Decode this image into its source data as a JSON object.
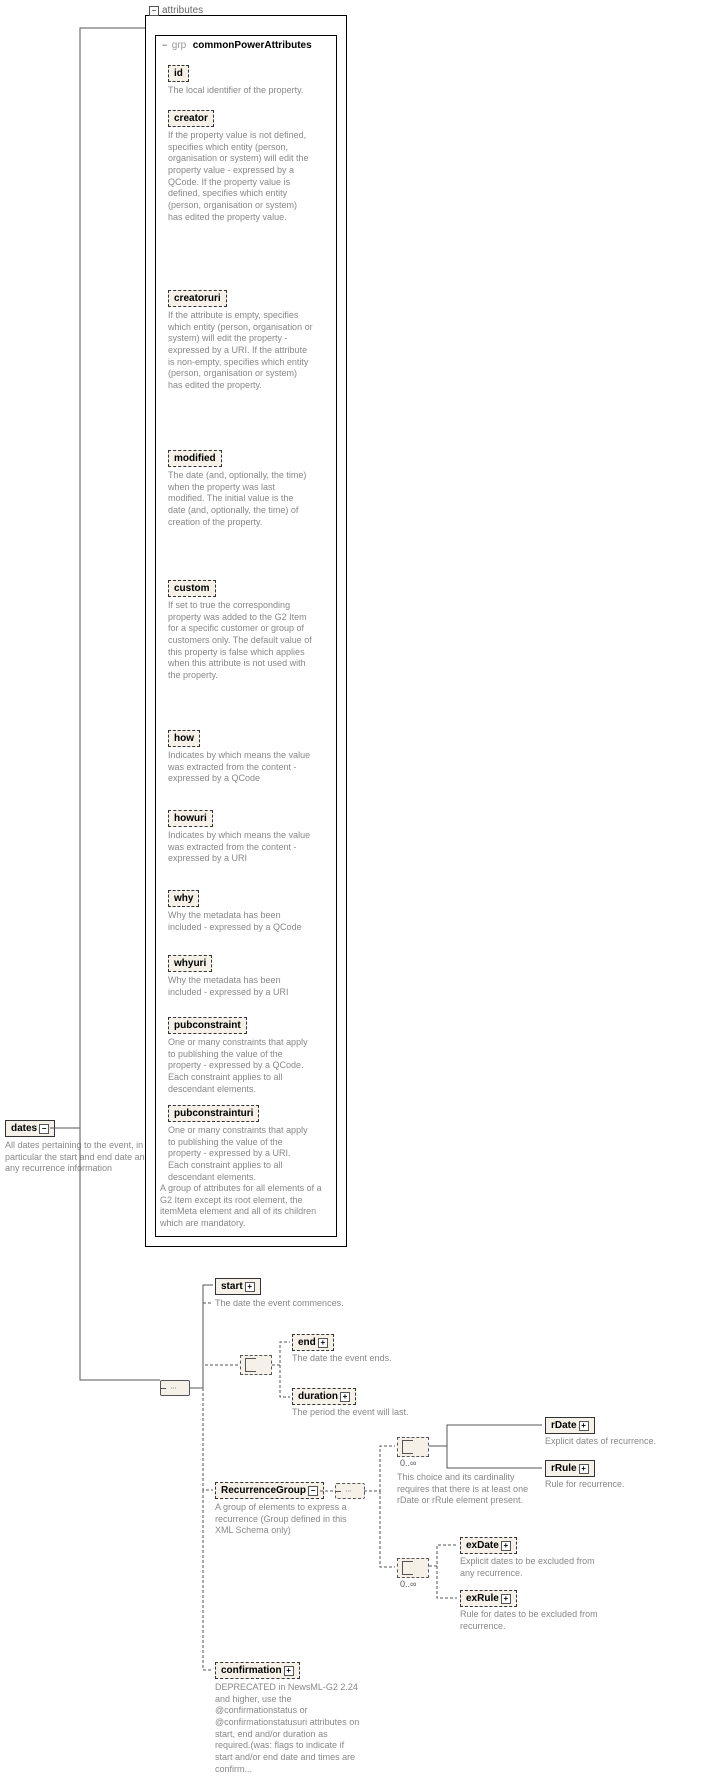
{
  "root": {
    "dates": {
      "label": "dates",
      "desc": "All dates pertaining to the event, in particular the start and end date and any recurrence information"
    }
  },
  "attributes": {
    "label": "attributes",
    "group": {
      "prefix": "grp",
      "name": "commonPowerAttributes",
      "footer_desc": "A group of attributes for all elements of a G2 Item except its root element, the itemMeta element and all of its children which are mandatory.",
      "items": [
        {
          "name": "id",
          "desc": "The local identifier of the property."
        },
        {
          "name": "creator",
          "desc": "If the property value is not defined, specifies which entity (person, organisation or system) will edit the property value - expressed by a QCode. If the property value is defined, specifies which entity (person, organisation or system) has edited the property value."
        },
        {
          "name": "creatoruri",
          "desc": "If the attribute is empty, specifies which entity (person, organisation or system) will edit the property - expressed by a URI. If the attribute is non-empty, specifies which entity (person, organisation or system) has edited the property."
        },
        {
          "name": "modified",
          "desc": "The date (and, optionally, the time) when the property was last modified. The initial value is the date (and, optionally, the time) of creation of the property."
        },
        {
          "name": "custom",
          "desc": "If set to true the corresponding property was added to the G2 Item for a specific customer or group of customers only. The default value of this property is false which applies when this attribute is not used with the property."
        },
        {
          "name": "how",
          "desc": "Indicates by which means the value was extracted from the content - expressed by a QCode"
        },
        {
          "name": "howuri",
          "desc": "Indicates by which means the value was extracted from the content - expressed by a URI"
        },
        {
          "name": "why",
          "desc": "Why the metadata has been included - expressed by a QCode"
        },
        {
          "name": "whyuri",
          "desc": "Why the metadata has been included - expressed by a URI"
        },
        {
          "name": "pubconstraint",
          "desc": "One or many constraints that apply to publishing the value of the property - expressed by a QCode. Each constraint applies to all descendant elements."
        },
        {
          "name": "pubconstrainturi",
          "desc": "One or many constraints that apply to publishing the value of the property - expressed by a URI. Each constraint applies to all descendant elements."
        }
      ]
    }
  },
  "elements": {
    "start": {
      "label": "start",
      "desc": "The date the event commences."
    },
    "end": {
      "label": "end",
      "desc": "The date the event ends."
    },
    "duration": {
      "label": "duration",
      "desc": "The period the event will last."
    },
    "recurrenceGroup": {
      "label": "RecurrenceGroup",
      "desc": "A group of elements to express a recurrence (Group defined in this XML Schema only)"
    },
    "recurrenceChoiceDesc": "This choice and its cardinality requires that there is at least one rDate or rRule element present.",
    "rDate": {
      "label": "rDate",
      "desc": "Explicit dates of recurrence."
    },
    "rRule": {
      "label": "rRule",
      "desc": "Rule for recurrence."
    },
    "exDate": {
      "label": "exDate",
      "desc": "Explicit dates to be excluded from any recurrence."
    },
    "exRule": {
      "label": "exRule",
      "desc": "Rule for dates to be excluded from recurrence."
    },
    "confirmation": {
      "label": "confirmation",
      "desc": "DEPRECATED in NewsML-G2 2.24 and higher, use the @confirmationstatus or @confirmationstatusuri attributes on start, end and/or duration as required.(was: flags to indicate if start and/or end date and times are confirm..."
    }
  },
  "cards": {
    "oneToInf": "0..∞"
  }
}
